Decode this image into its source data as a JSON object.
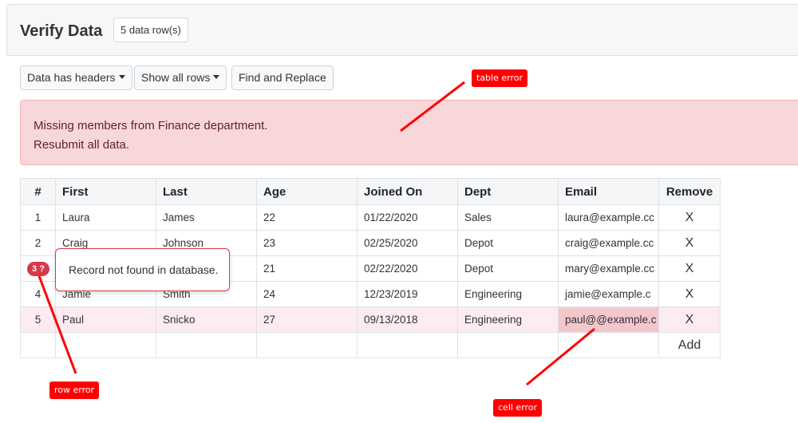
{
  "header": {
    "title": "Verify Data",
    "row_count": "5 data row(s)"
  },
  "toolbar": {
    "headers_label": "Data has headers",
    "rows_label": "Show all rows",
    "find_replace_label": "Find and Replace"
  },
  "alert": {
    "line1": "Missing members from Finance department.",
    "line2": "Resubmit all data."
  },
  "table": {
    "columns": [
      "#",
      "First",
      "Last",
      "Age",
      "Joined On",
      "Dept",
      "Email",
      "Remove"
    ],
    "rows": [
      {
        "num": "1",
        "first": "Laura",
        "last": "James",
        "age": "22",
        "joined": "01/22/2020",
        "dept": "Sales",
        "email": "laura@example.cc",
        "remove": "X"
      },
      {
        "num": "2",
        "first": "Craig",
        "last": "Johnson",
        "age": "23",
        "joined": "02/25/2020",
        "dept": "Depot",
        "email": "craig@example.cc",
        "remove": "X"
      },
      {
        "num": "3",
        "first": "",
        "last": "",
        "age": "21",
        "joined": "02/22/2020",
        "dept": "Depot",
        "email": "mary@example.cc",
        "remove": "X"
      },
      {
        "num": "4",
        "first": "Jamie",
        "last": "Smith",
        "age": "24",
        "joined": "12/23/2019",
        "dept": "Engineering",
        "email": "jamie@example.c",
        "remove": "X"
      },
      {
        "num": "5",
        "first": "Paul",
        "last": "Snicko",
        "age": "27",
        "joined": "09/13/2018",
        "dept": "Engineering",
        "email": "paul@@example.c",
        "remove": "X"
      }
    ],
    "add_label": "Add"
  },
  "row_error": {
    "badge": "3 ?",
    "message": "Record not found in database."
  },
  "annotations": {
    "table_error": "table error",
    "row_error": "row error",
    "cell_error": "cell error"
  },
  "colors": {
    "alert_bg": "#f8d7da",
    "error_red": "#d9384a",
    "annotation_red": "#ff0000",
    "link_blue": "#1a73e8"
  }
}
